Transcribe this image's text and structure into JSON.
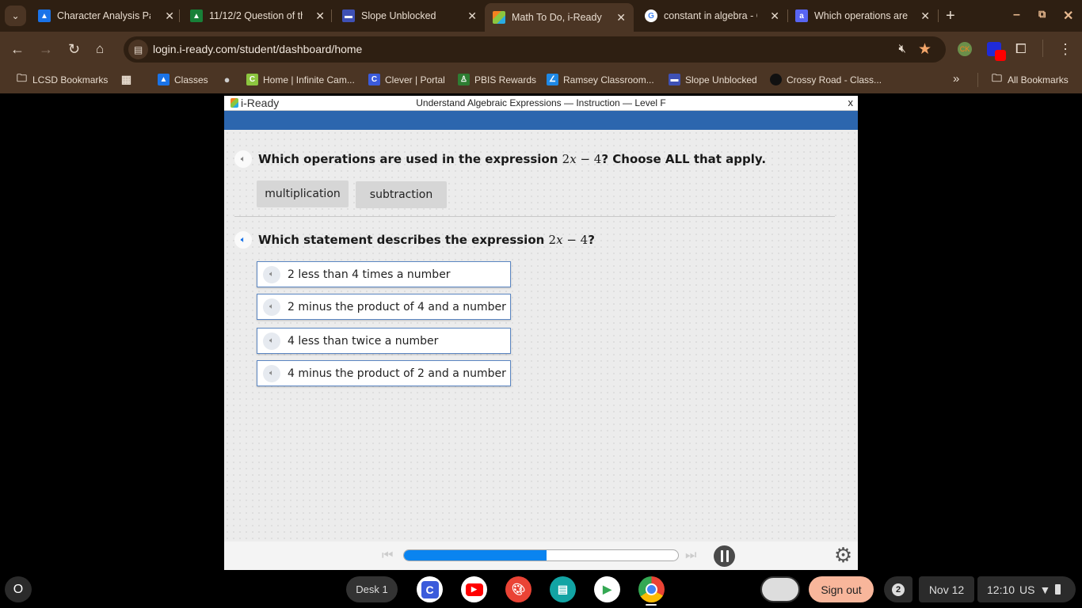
{
  "browser": {
    "tabs": [
      {
        "title": "Character Analysis Pa",
        "icon": "google-classroom-icon",
        "color": "#1a73e8",
        "active": false
      },
      {
        "title": "11/12/2 Question of th",
        "icon": "google-classroom-icon",
        "color": "#188038",
        "active": false
      },
      {
        "title": "Slope Unblocked",
        "icon": "slope-site-icon",
        "color": "#3f51b5",
        "active": false
      },
      {
        "title": "Math To Do, i-Ready",
        "icon": "iready-cube-icon",
        "color": "#8cc63f",
        "active": true
      },
      {
        "title": "constant in algebra - G",
        "icon": "google-icon",
        "color": "#4285f4",
        "active": false
      },
      {
        "title": "Which operations are u",
        "icon": "site-icon",
        "color": "#5865f2",
        "active": false
      }
    ],
    "new_tab_label": "+",
    "url": "login.i-ready.com/student/dashboard/home",
    "bookmarks": [
      {
        "label": "LCSD Bookmarks",
        "icon": "folder-settings-icon"
      },
      {
        "label": "",
        "icon": "apps-grid-icon"
      },
      {
        "label": "Classes",
        "icon": "google-classroom-icon"
      },
      {
        "label": "",
        "icon": "globe-icon"
      },
      {
        "label": "Home | Infinite Cam...",
        "icon": "infinite-campus-icon"
      },
      {
        "label": "Clever | Portal",
        "icon": "clever-icon"
      },
      {
        "label": "PBIS Rewards",
        "icon": "pbis-icon"
      },
      {
        "label": "Ramsey Classroom...",
        "icon": "ramsey-icon"
      },
      {
        "label": "Slope Unblocked",
        "icon": "slope-site-icon"
      },
      {
        "label": "Crossy Road - Class...",
        "icon": "crossy-road-icon"
      }
    ],
    "all_bookmarks_label": "All Bookmarks",
    "more_bookmarks_label": "»"
  },
  "lesson": {
    "brand": "i-Ready",
    "title": "Understand Algebraic Expressions — Instruction — Level F",
    "close_label": "x",
    "question1": {
      "prefix": "Which operations are used in the expression ",
      "math_coef": "2",
      "math_var": "x",
      "math_rest": " − 4",
      "suffix": "? Choose ALL that apply.",
      "chips": [
        "multiplication",
        "subtraction"
      ]
    },
    "question2": {
      "prefix": "Which statement describes the expression ",
      "math_coef": "2",
      "math_var": "x",
      "math_rest": " − 4",
      "suffix": "?",
      "options": [
        "2 less than 4 times a number",
        "2 minus the product of 4 and a number",
        "4 less than twice a number",
        "4 minus the product of 2 and a number"
      ]
    },
    "player": {
      "progress_fraction": 0.52,
      "accent": "#0a84f0"
    }
  },
  "shelf": {
    "launcher_label": "O",
    "desk_label": "Desk 1",
    "sign_out_label": "Sign out",
    "notification_count": "2",
    "date": "Nov 12",
    "time": "12:10",
    "locale": "US"
  }
}
